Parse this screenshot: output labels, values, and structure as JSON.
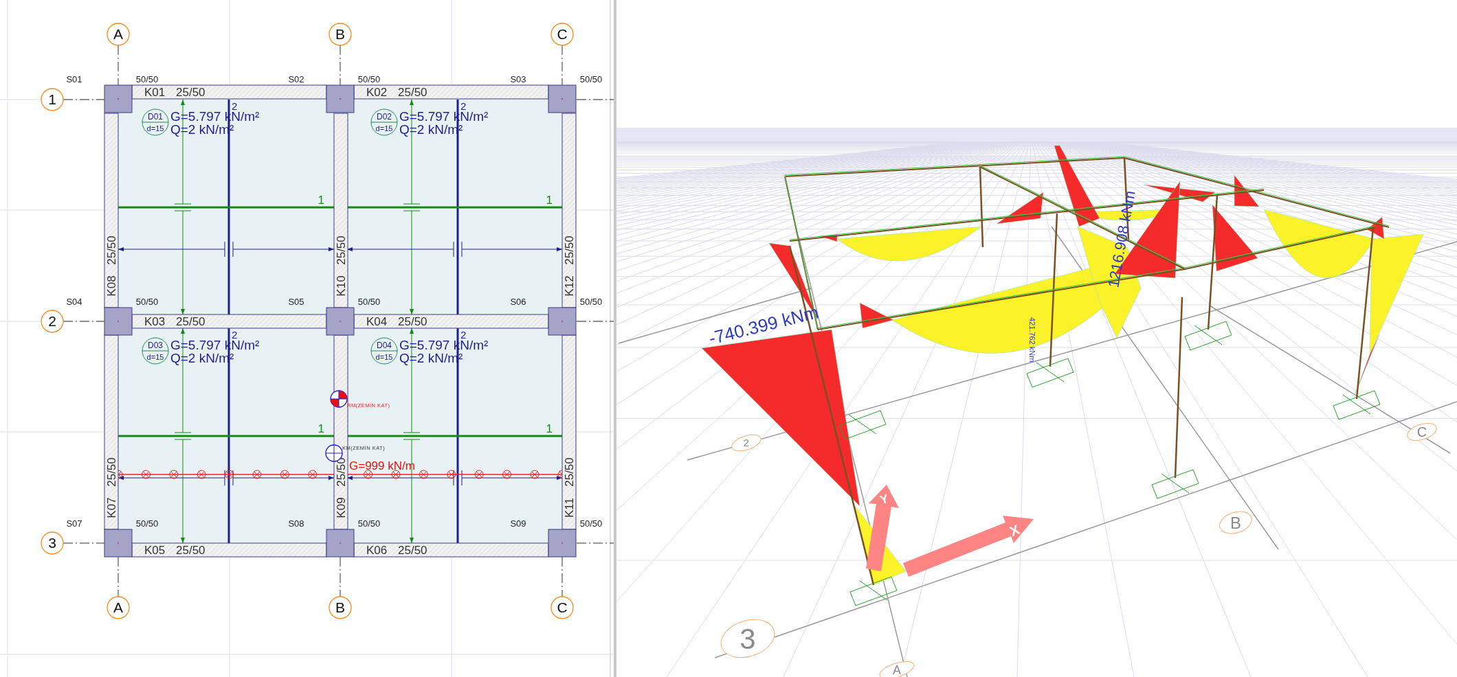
{
  "plan": {
    "grid_columns": [
      {
        "label": "A"
      },
      {
        "label": "B"
      },
      {
        "label": "C"
      }
    ],
    "grid_rows": [
      {
        "label": "1"
      },
      {
        "label": "2"
      },
      {
        "label": "3"
      }
    ],
    "bottom_grid_columns": [
      {
        "label": "A"
      },
      {
        "label": "B"
      },
      {
        "label": "C"
      }
    ],
    "columns": [
      {
        "label": "S01",
        "size": "50/50"
      },
      {
        "label": "S02",
        "size": "50/50"
      },
      {
        "label": "S03",
        "size": "50/50"
      },
      {
        "label": "S04",
        "size": "50/50"
      },
      {
        "label": "S05",
        "size": "50/50"
      },
      {
        "label": "S06",
        "size": "50/50"
      },
      {
        "label": "S07",
        "size": "50/50"
      },
      {
        "label": "S08",
        "size": "50/50"
      },
      {
        "label": "S09",
        "size": "50/50"
      }
    ],
    "beams": [
      {
        "label": "K01",
        "size": "25/50"
      },
      {
        "label": "K02",
        "size": "25/50"
      },
      {
        "label": "K03",
        "size": "25/50"
      },
      {
        "label": "K04",
        "size": "25/50"
      },
      {
        "label": "K05",
        "size": "25/50"
      },
      {
        "label": "K06",
        "size": "25/50"
      },
      {
        "label": "K07",
        "size": "25/50"
      },
      {
        "label": "K08",
        "size": "25/50"
      },
      {
        "label": "K09",
        "size": "25/50"
      },
      {
        "label": "K10",
        "size": "25/50"
      },
      {
        "label": "K11",
        "size": "25/50"
      },
      {
        "label": "K12",
        "size": "25/50"
      }
    ],
    "slabs": [
      {
        "label": "D01",
        "thickness": "d=15",
        "dead_load": "G=5.797 kN/m²",
        "live_load": "Q=2 kN/m²",
        "direction_1": "1",
        "direction_2": "2"
      },
      {
        "label": "D02",
        "thickness": "d=15",
        "dead_load": "G=5.797 kN/m²",
        "live_load": "Q=2 kN/m²",
        "direction_1": "1",
        "direction_2": "2"
      },
      {
        "label": "D03",
        "thickness": "d=15",
        "dead_load": "G=5.797 kN/m²",
        "live_load": "Q=2 kN/m²",
        "direction_1": "1",
        "direction_2": "2"
      },
      {
        "label": "D04",
        "thickness": "d=15",
        "dead_load": "G=5.797 kN/m²",
        "live_load": "Q=2 kN/m²",
        "direction_1": "1",
        "direction_2": "2"
      }
    ],
    "centers": [
      {
        "kind": "rigidity",
        "label": "RM(ZEMİN KAT)"
      },
      {
        "kind": "mass",
        "label": "KM(ZEMİN KAT)"
      }
    ],
    "line_load": {
      "label": "G=999 kN/m"
    }
  },
  "view_3d": {
    "moment_labels": [
      {
        "text": "-740.399 kNm"
      },
      {
        "text": "1216.908 kNm"
      },
      {
        "text": "421.762 kNm"
      }
    ],
    "axes": [
      {
        "label": "X"
      },
      {
        "label": "Y"
      }
    ],
    "grid_bubbles": [
      {
        "label": "3"
      },
      {
        "label": "2"
      },
      {
        "label": "B"
      },
      {
        "label": "C"
      },
      {
        "label": "A"
      }
    ]
  }
}
